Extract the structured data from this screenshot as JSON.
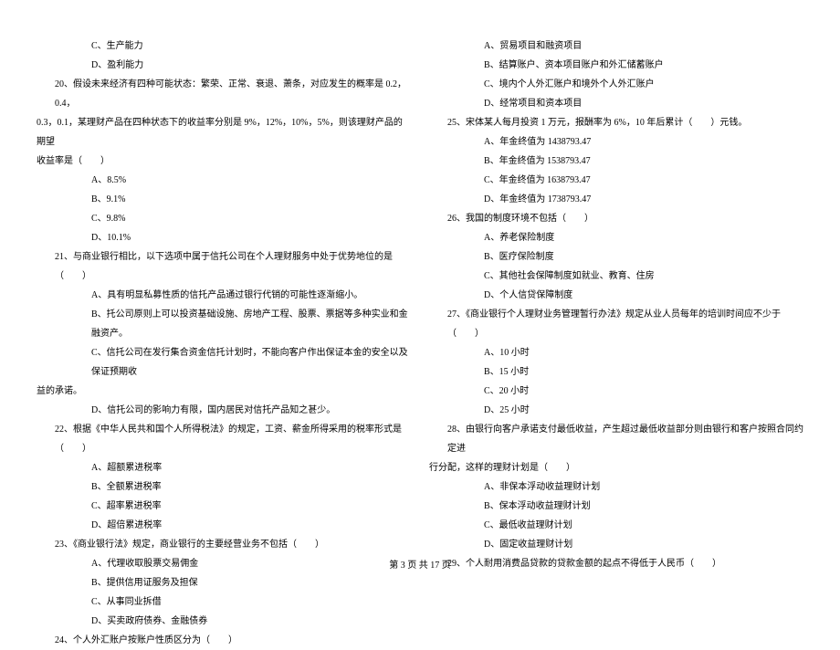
{
  "left": {
    "q19_c": "C、生产能力",
    "q19_d": "D、盈利能力",
    "q20_stem1": "20、假设未来经济有四种可能状态：繁荣、正常、衰退、萧条，对应发生的概率是 0.2，0.4，",
    "q20_stem2": "0.3，0.1，某理财产品在四种状态下的收益率分别是 9%，12%，10%，5%，则该理财产品的期望",
    "q20_stem3": "收益率是（　　）",
    "q20_a": "A、8.5%",
    "q20_b": "B、9.1%",
    "q20_c": "C、9.8%",
    "q20_d": "D、10.1%",
    "q21_stem": "21、与商业银行相比，以下选项中属于信托公司在个人理财服务中处于优势地位的是（　　）",
    "q21_a": "A、具有明显私募性质的信托产品通过银行代销的可能性逐渐缩小。",
    "q21_b": "B、托公司原则上可以投资基础设施、房地产工程、股票、票据等多种实业和金融资产。",
    "q21_c1": "C、信托公司在发行集合资金信托计划时，不能向客户作出保证本金的安全以及保证预期收",
    "q21_c2": "益的承诺。",
    "q21_d": "D、信托公司的影响力有限，国内居民对信托产品知之甚少。",
    "q22_stem": "22、根据《中华人民共和国个人所得税法》的规定，工资、薪金所得采用的税率形式是（　　）",
    "q22_a": "A、超额累进税率",
    "q22_b": "B、全额累进税率",
    "q22_c": "C、超率累进税率",
    "q22_d": "D、超倍累进税率",
    "q23_stem": "23、《商业银行法》规定，商业银行的主要经营业务不包括（　　）",
    "q23_a": "A、代理收取股票交易佣金",
    "q23_b": "B、提供信用证服务及担保",
    "q23_c": "C、从事同业拆借",
    "q23_d": "D、买卖政府债券、金融债券",
    "q24_stem": "24、个人外汇账户按账户性质区分为（　　）"
  },
  "right": {
    "q24_a": "A、贸易项目和融资项目",
    "q24_b": "B、结算账户、资本项目账户和外汇储蓄账户",
    "q24_c": "C、境内个人外汇账户和境外个人外汇账户",
    "q24_d": "D、经常项目和资本项目",
    "q25_stem": "25、宋体某人每月投资 1 万元，报酬率为 6%，10 年后累计（　　）元钱。",
    "q25_a": "A、年金终值为 1438793.47",
    "q25_b": "B、年金终值为 1538793.47",
    "q25_c": "C、年金终值为 1638793.47",
    "q25_d": "D、年金终值为 1738793.47",
    "q26_stem": "26、我国的制度环境不包括（　　）",
    "q26_a": "A、养老保险制度",
    "q26_b": "B、医疗保险制度",
    "q26_c": "C、其他社会保障制度如就业、教育、住房",
    "q26_d": "D、个人信贷保障制度",
    "q27_stem": "27、《商业银行个人理财业务管理暂行办法》规定从业人员每年的培训时间应不少于（　　）",
    "q27_a": "A、10 小时",
    "q27_b": "B、15 小时",
    "q27_c": "C、20 小时",
    "q27_d": "D、25 小时",
    "q28_stem1": "28、由银行向客户承诺支付最低收益，产生超过最低收益部分则由银行和客户按照合同约定进",
    "q28_stem2": "行分配，这样的理财计划是（　　）",
    "q28_a": "A、非保本浮动收益理财计划",
    "q28_b": "B、保本浮动收益理财计划",
    "q28_c": "C、最低收益理财计划",
    "q28_d": "D、固定收益理财计划",
    "q29_stem": "29、个人耐用消费品贷款的贷款金额的起点不得低于人民币（　　）"
  },
  "footer": "第 3 页 共 17 页"
}
